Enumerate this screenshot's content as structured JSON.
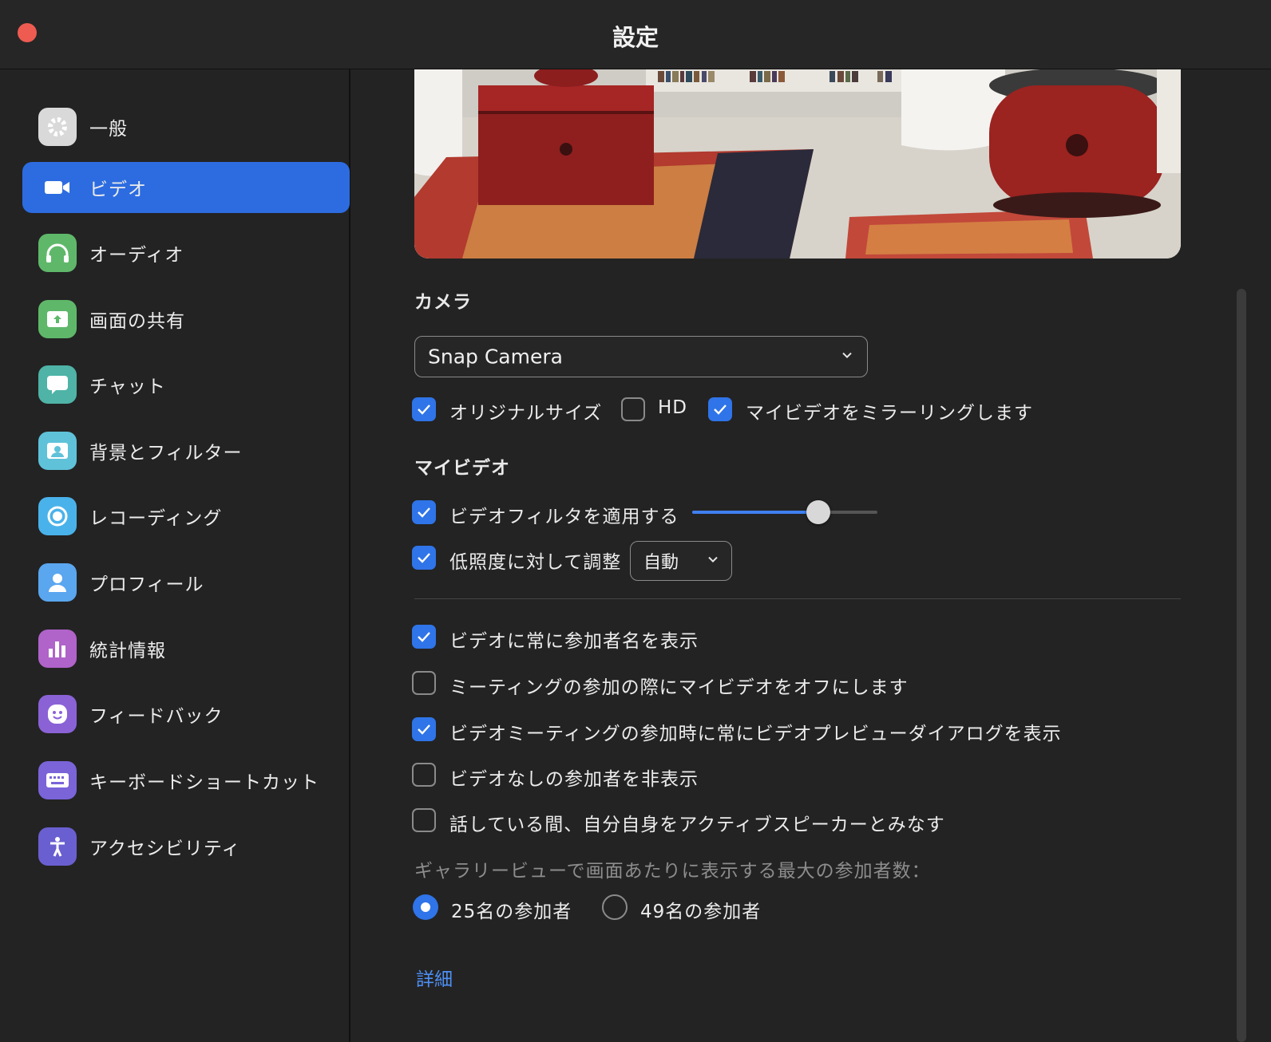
{
  "window": {
    "title": "設定"
  },
  "sidebar": {
    "items": [
      {
        "label": "一般",
        "icon": "gear-icon",
        "color": "#d9d9d9",
        "active": false
      },
      {
        "label": "ビデオ",
        "icon": "video-camera-icon",
        "color": "#2d6ce0",
        "active": true
      },
      {
        "label": "オーディオ",
        "icon": "headphones-icon",
        "color": "#5fb86a",
        "active": false
      },
      {
        "label": "画面の共有",
        "icon": "share-screen-icon",
        "color": "#5fb86a",
        "active": false
      },
      {
        "label": "チャット",
        "icon": "chat-bubble-icon",
        "color": "#4fb3a7",
        "active": false
      },
      {
        "label": "背景とフィルター",
        "icon": "background-portrait-icon",
        "color": "#5fc2d9",
        "active": false
      },
      {
        "label": "レコーディング",
        "icon": "record-icon",
        "color": "#4ab2ea",
        "active": false
      },
      {
        "label": "プロフィール",
        "icon": "profile-icon",
        "color": "#5aa6ef",
        "active": false
      },
      {
        "label": "統計情報",
        "icon": "statistics-icon",
        "color": "#b063c9",
        "active": false
      },
      {
        "label": "フィードバック",
        "icon": "smiley-icon",
        "color": "#8a62d6",
        "active": false
      },
      {
        "label": "キーボードショートカット",
        "icon": "keyboard-icon",
        "color": "#7a64d8",
        "active": false
      },
      {
        "label": "アクセシビリティ",
        "icon": "accessibility-icon",
        "color": "#6a5fd0",
        "active": false
      }
    ]
  },
  "camera": {
    "section_title": "カメラ",
    "selected": "Snap Camera",
    "options": [
      {
        "label": "オリジナルサイズ",
        "checked": true
      },
      {
        "label": "HD",
        "checked": false
      },
      {
        "label": "マイビデオをミラーリングします",
        "checked": true
      }
    ]
  },
  "my_video": {
    "section_title": "マイビデオ",
    "filter": {
      "label": "ビデオフィルタを適用する",
      "checked": true,
      "level": 0.68
    },
    "low_light": {
      "label": "低照度に対して調整",
      "checked": true,
      "mode": "自動"
    }
  },
  "options": [
    {
      "label": "ビデオに常に参加者名を表示",
      "checked": true
    },
    {
      "label": "ミーティングの参加の際にマイビデオをオフにします",
      "checked": false
    },
    {
      "label": "ビデオミーティングの参加時に常にビデオプレビューダイアログを表示",
      "checked": true
    },
    {
      "label": "ビデオなしの参加者を非表示",
      "checked": false
    },
    {
      "label": "話している間、自分自身をアクティブスピーカーとみなす",
      "checked": false
    }
  ],
  "gallery": {
    "label": "ギャラリービューで画面あたりに表示する最大の参加者数：",
    "choices": [
      {
        "label": "25名の参加者",
        "selected": true
      },
      {
        "label": "49名の参加者",
        "selected": false
      }
    ]
  },
  "advanced_link": "詳細",
  "accent_color": "#2f74e8"
}
